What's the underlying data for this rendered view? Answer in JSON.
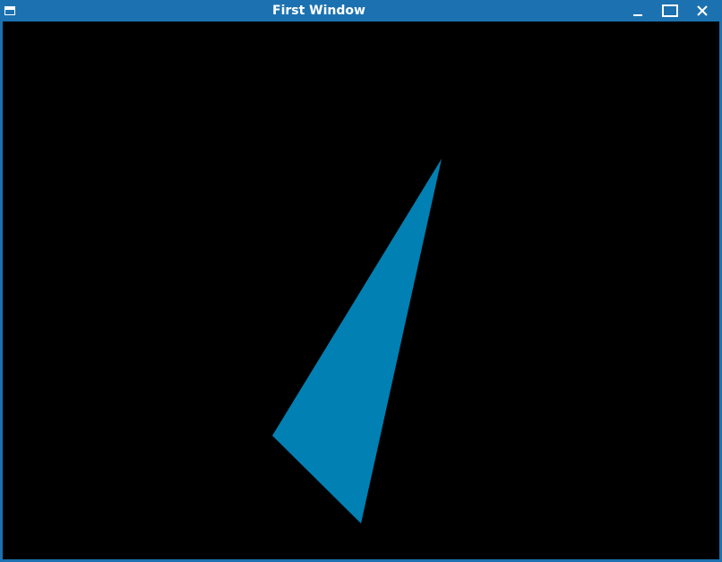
{
  "window": {
    "title": "First Window",
    "controls": {
      "minimize_icon": "minimize-icon",
      "maximize_icon": "maximize-icon",
      "close_icon": "close-icon"
    }
  },
  "canvas": {
    "background": "#000000",
    "shape": "triangle",
    "shape_color": "#0080b3"
  },
  "colors": {
    "titlebar": "#1c72b0",
    "title_text": "#ffffff"
  }
}
